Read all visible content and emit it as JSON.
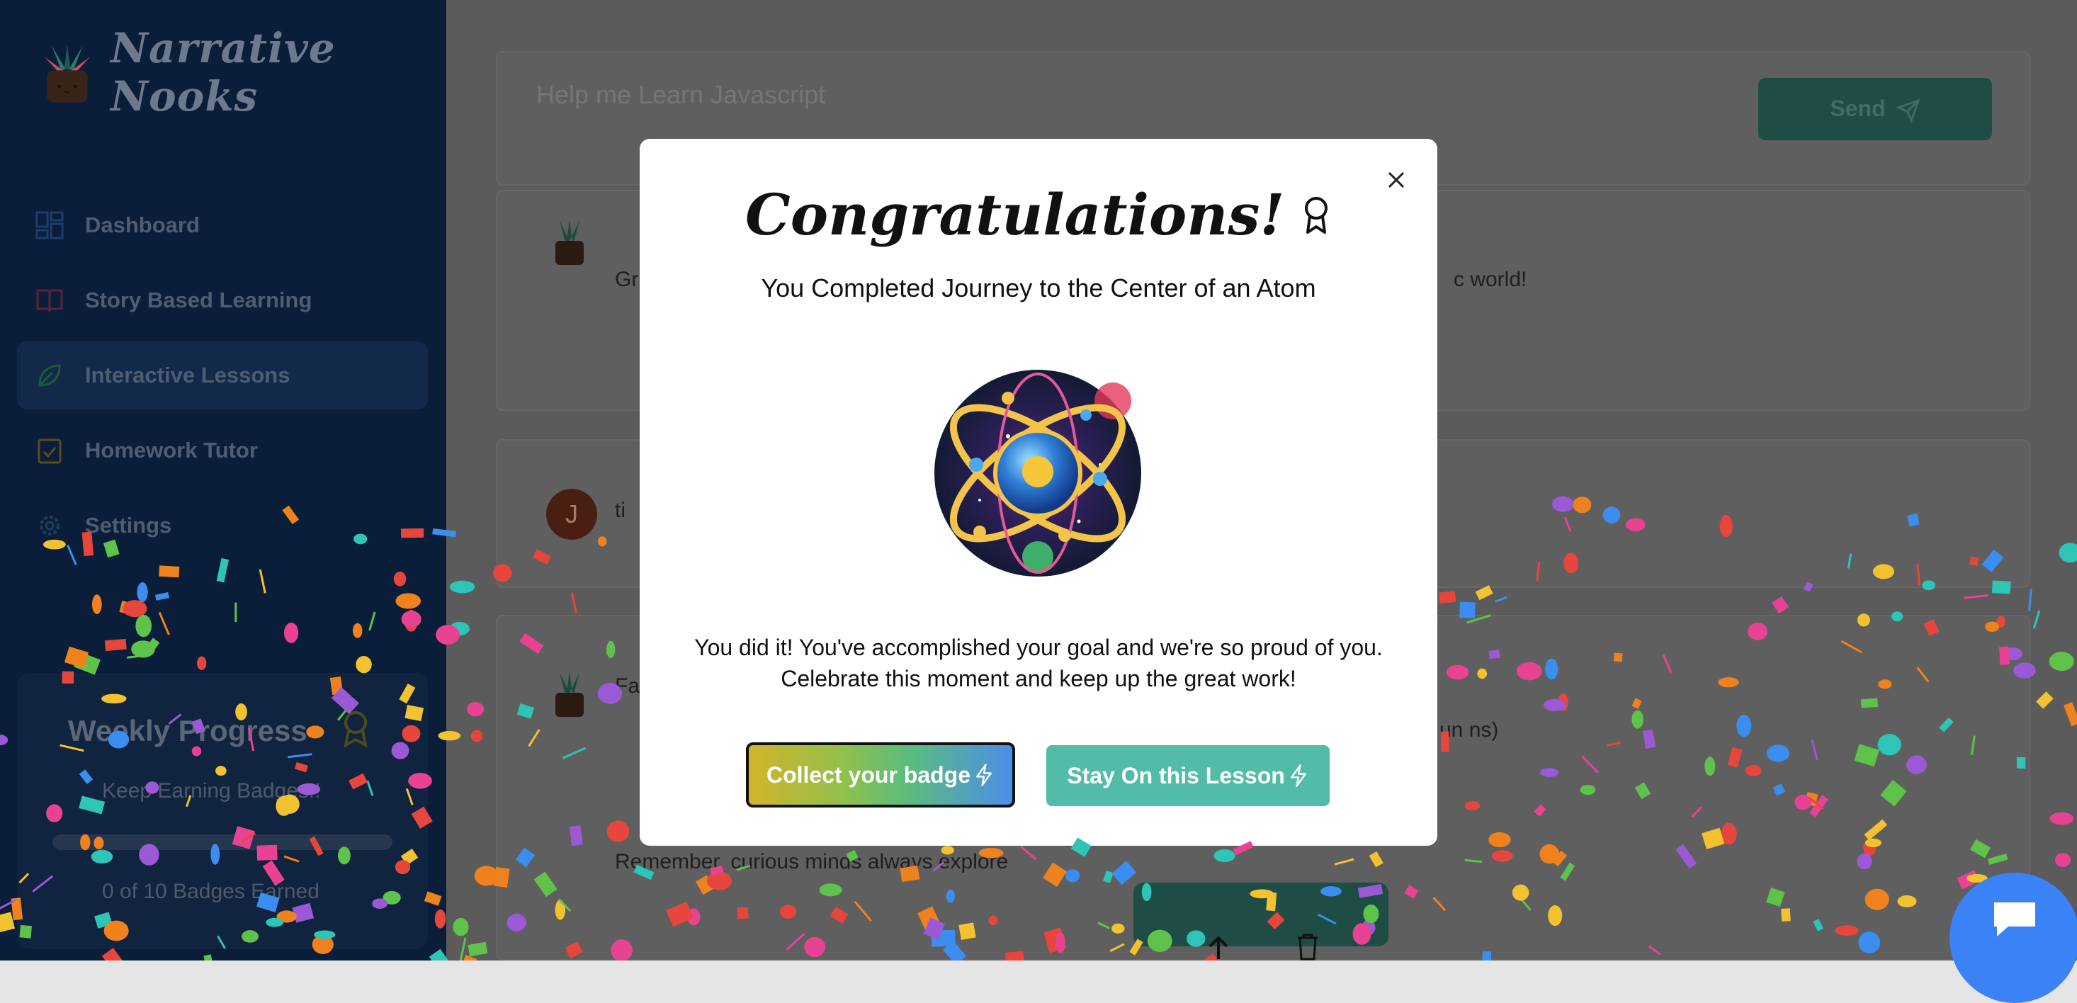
{
  "app": {
    "name": "Narrative Nooks"
  },
  "sidebar": {
    "items": [
      {
        "label": "Dashboard",
        "icon": "dashboard-icon",
        "active": false
      },
      {
        "label": "Story Based Learning",
        "icon": "book-icon",
        "active": false
      },
      {
        "label": "Interactive Lessons",
        "icon": "leaf-icon",
        "active": true
      },
      {
        "label": "Homework Tutor",
        "icon": "clipboard-icon",
        "active": false
      },
      {
        "label": "Settings",
        "icon": "gear-icon",
        "active": false
      }
    ],
    "progress": {
      "title": "Weekly Progress",
      "subtitle": "Keep Earning Badges!!",
      "count_text": "0 of 10 Badges Earned",
      "fraction": 0.0
    }
  },
  "chat": {
    "input_placeholder": "Help me Learn Javascript",
    "send_label": "Send",
    "bot_line_start": "Gr",
    "bot_line_end": "c world!",
    "user_avatar_letter": "J",
    "user_text_start": "ti",
    "list_intro": "Fa",
    "list_tail": "un ns)",
    "closing_line": "Remember, curious minds always explore"
  },
  "modal": {
    "title": "Congratulations!",
    "subtitle": "You Completed Journey to the Center of an Atom",
    "message_line1": "You did it! You've accomplished your goal and we're so proud of you.",
    "message_line2": "Celebrate this moment and keep up the great work!",
    "collect_label": "Collect your badge",
    "stay_label": "Stay On this Lesson"
  },
  "colors": {
    "sidebar_bg": "#0a1e3a",
    "accent_teal": "#52bca9",
    "fab_blue": "#3b82f6"
  }
}
